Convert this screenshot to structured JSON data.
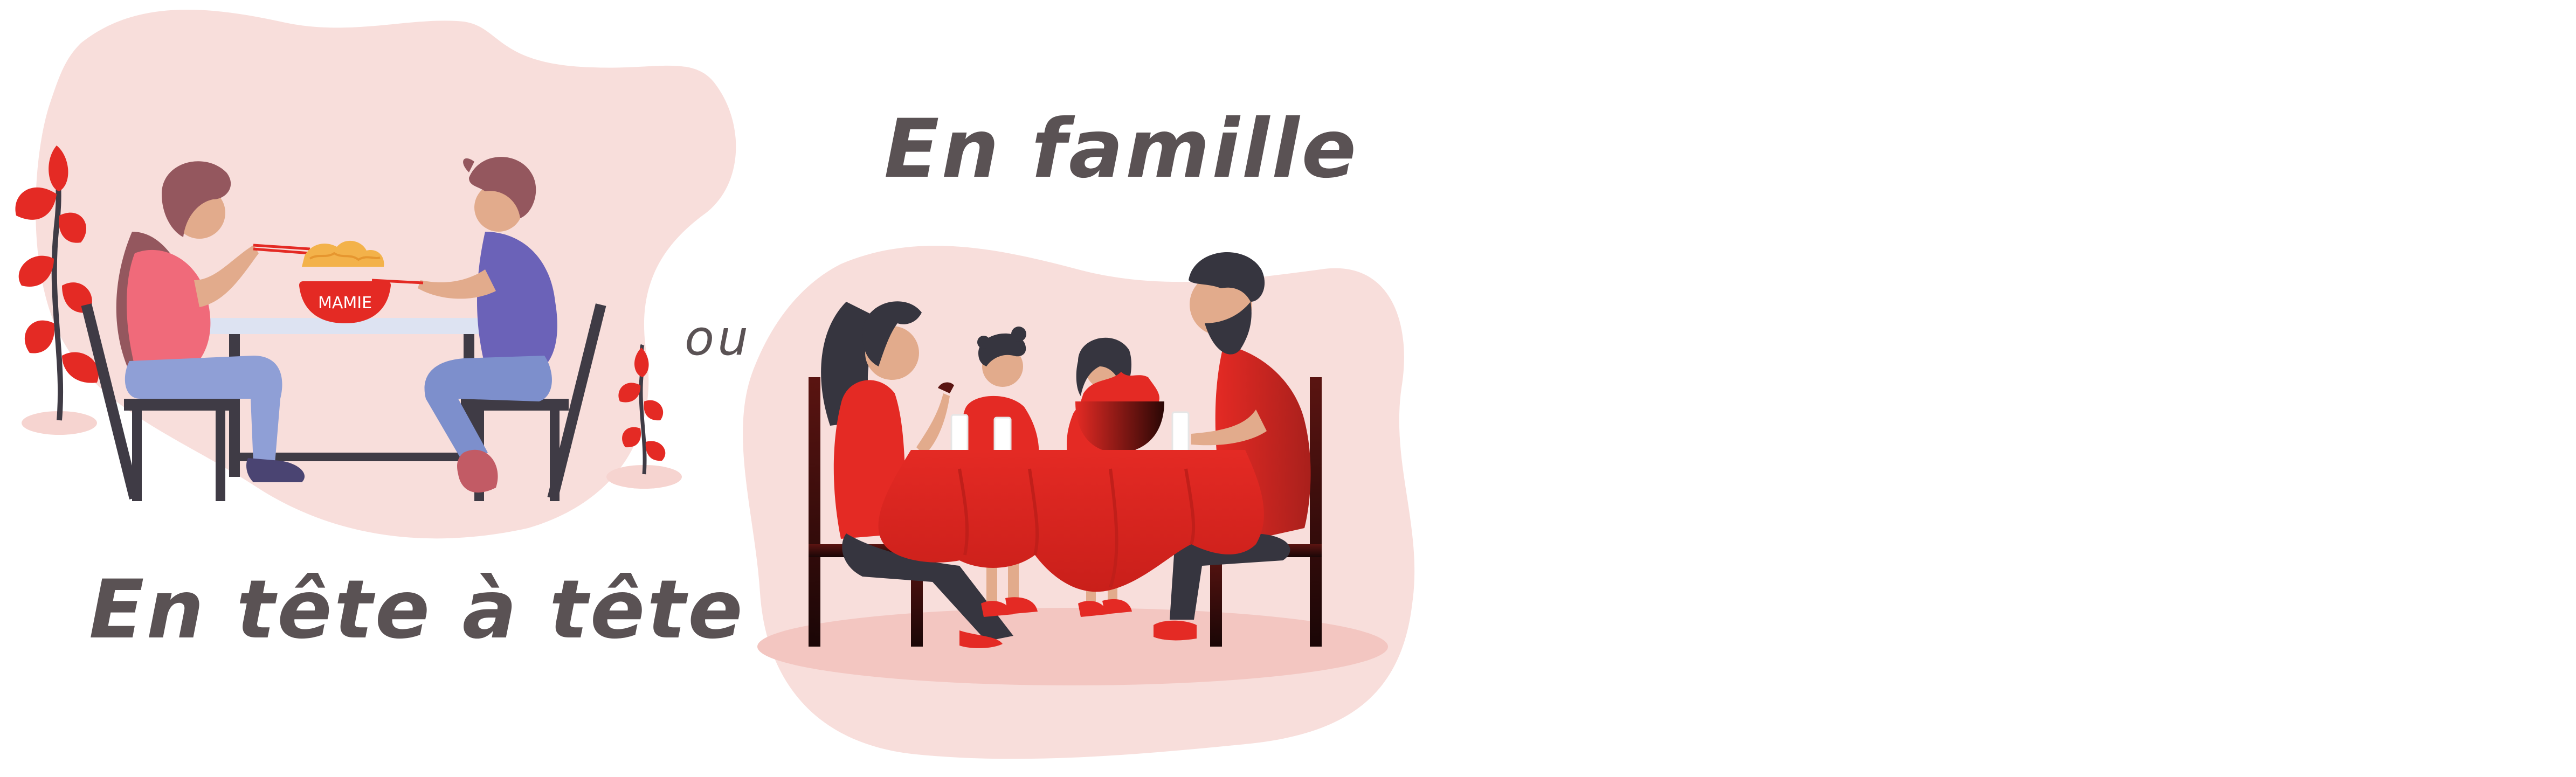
{
  "captions": {
    "couple": "En tête à tête",
    "family": "En famille",
    "or": "ou"
  },
  "bowl_label": "MAMIE",
  "colors": {
    "accent_red": "#e42a24",
    "dark_red": "#8c1a17",
    "blob_pink": "#f8dedb",
    "floor_pink": "#f3c6c1",
    "text_gray": "#5a5254",
    "chair_dark": "#3f3b45",
    "denim": "#7d8fcc",
    "skin": "#e2ab8c",
    "hair_brown": "#94575e",
    "hair_dark": "#36353f"
  },
  "icons": [
    "couple-dining-illustration",
    "family-dining-illustration",
    "leaf-plant-icon",
    "noodle-bowl-icon",
    "wine-glass-icon"
  ]
}
